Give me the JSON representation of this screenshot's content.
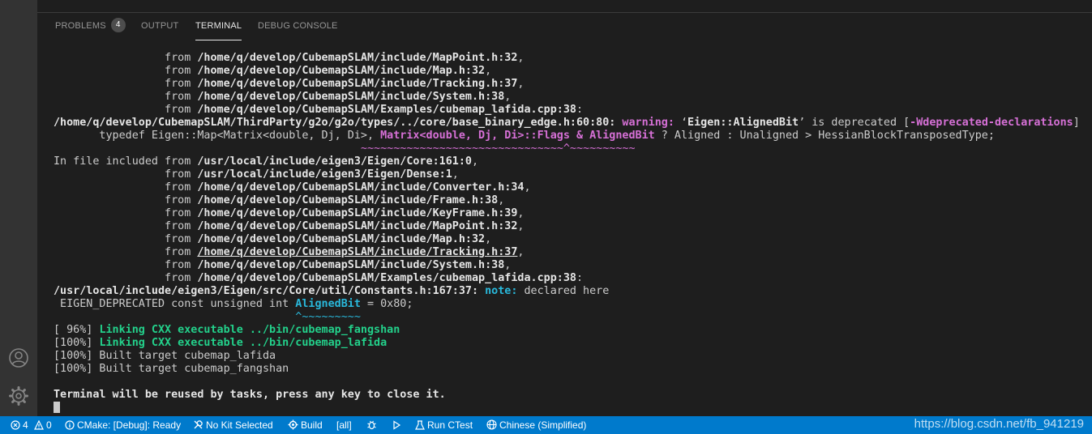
{
  "panel": {
    "tabs": [
      {
        "label": "PROBLEMS",
        "badge": "4"
      },
      {
        "label": "OUTPUT"
      },
      {
        "label": "TERMINAL"
      },
      {
        "label": "DEBUG CONSOLE"
      }
    ],
    "active_tab": "TERMINAL"
  },
  "terminal": {
    "lines": [
      [
        {
          "t": "                 from "
        },
        {
          "t": "/home/q/develop/CubemapSLAM/include/MapPoint.h:32",
          "c": "b"
        },
        {
          "t": ","
        }
      ],
      [
        {
          "t": "                 from "
        },
        {
          "t": "/home/q/develop/CubemapSLAM/include/Map.h:32",
          "c": "b"
        },
        {
          "t": ","
        }
      ],
      [
        {
          "t": "                 from "
        },
        {
          "t": "/home/q/develop/CubemapSLAM/include/Tracking.h:37",
          "c": "b"
        },
        {
          "t": ","
        }
      ],
      [
        {
          "t": "                 from "
        },
        {
          "t": "/home/q/develop/CubemapSLAM/include/System.h:38",
          "c": "b"
        },
        {
          "t": ","
        }
      ],
      [
        {
          "t": "                 from "
        },
        {
          "t": "/home/q/develop/CubemapSLAM/Examples/cubemap_lafida.cpp:38",
          "c": "b"
        },
        {
          "t": ":"
        }
      ],
      [
        {
          "t": "/home/q/develop/CubemapSLAM/ThirdParty/g2o/g2o/types/../core/base_binary_edge.h:60:80:",
          "c": "b"
        },
        {
          "t": " "
        },
        {
          "t": "warning:",
          "c": "warn"
        },
        {
          "t": " ‘"
        },
        {
          "t": "Eigen::AlignedBit",
          "c": "b"
        },
        {
          "t": "’ is deprecated ["
        },
        {
          "t": "-Wdeprecated-declarations",
          "c": "mag"
        },
        {
          "t": "]"
        }
      ],
      [
        {
          "t": "       typedef Eigen::Map<Matrix<double, Dj, Di>, "
        },
        {
          "t": "Matrix<double, Dj, Di>::Flags & AlignedBit",
          "c": "mag"
        },
        {
          "t": " ? Aligned : Unaligned > HessianBlockTransposedType;"
        }
      ],
      [
        {
          "t": "                                               ~~~~~~~~~~~~~~~~~~~~~~~~~~~~~~~^~~~~~~~~~~",
          "c": "magt"
        }
      ],
      [
        {
          "t": "In file included from "
        },
        {
          "t": "/usr/local/include/eigen3/Eigen/Core:161:0",
          "c": "b"
        },
        {
          "t": ","
        }
      ],
      [
        {
          "t": "                 from "
        },
        {
          "t": "/usr/local/include/eigen3/Eigen/Dense:1",
          "c": "b"
        },
        {
          "t": ","
        }
      ],
      [
        {
          "t": "                 from "
        },
        {
          "t": "/home/q/develop/CubemapSLAM/include/Converter.h:34",
          "c": "b"
        },
        {
          "t": ","
        }
      ],
      [
        {
          "t": "                 from "
        },
        {
          "t": "/home/q/develop/CubemapSLAM/include/Frame.h:38",
          "c": "b"
        },
        {
          "t": ","
        }
      ],
      [
        {
          "t": "                 from "
        },
        {
          "t": "/home/q/develop/CubemapSLAM/include/KeyFrame.h:39",
          "c": "b"
        },
        {
          "t": ","
        }
      ],
      [
        {
          "t": "                 from "
        },
        {
          "t": "/home/q/develop/CubemapSLAM/include/MapPoint.h:32",
          "c": "b"
        },
        {
          "t": ","
        }
      ],
      [
        {
          "t": "                 from "
        },
        {
          "t": "/home/q/develop/CubemapSLAM/include/Map.h:32",
          "c": "b"
        },
        {
          "t": ","
        }
      ],
      [
        {
          "t": "                 from "
        },
        {
          "t": "/home/q/develop/CubemapSLAM/include/Tracking.h:37",
          "c": "b ul"
        },
        {
          "t": ","
        }
      ],
      [
        {
          "t": "                 from "
        },
        {
          "t": "/home/q/develop/CubemapSLAM/include/System.h:38",
          "c": "b"
        },
        {
          "t": ","
        }
      ],
      [
        {
          "t": "                 from "
        },
        {
          "t": "/home/q/develop/CubemapSLAM/Examples/cubemap_lafida.cpp:38",
          "c": "b"
        },
        {
          "t": ":"
        }
      ],
      [
        {
          "t": "/usr/local/include/eigen3/Eigen/src/Core/util/Constants.h:167:37:",
          "c": "b"
        },
        {
          "t": " "
        },
        {
          "t": "note:",
          "c": "note"
        },
        {
          "t": " declared here"
        }
      ],
      [
        {
          "t": " EIGEN_DEPRECATED const unsigned int "
        },
        {
          "t": "AlignedBit",
          "c": "cyan"
        },
        {
          "t": " = 0x80;"
        }
      ],
      [
        {
          "t": "                                     ^~~~~~~~~~",
          "c": "cyant"
        }
      ],
      [
        {
          "t": "[ 96%] "
        },
        {
          "t": "Linking CXX executable ../bin/cubemap_fangshan",
          "c": "green"
        }
      ],
      [
        {
          "t": "[100%] "
        },
        {
          "t": "Linking CXX executable ../bin/cubemap_lafida",
          "c": "green"
        }
      ],
      [
        {
          "t": "[100%] Built target cubemap_lafida"
        }
      ],
      [
        {
          "t": "[100%] Built target cubemap_fangshan"
        }
      ],
      [
        {
          "t": ""
        }
      ],
      [
        {
          "t": "Terminal will be reused by tasks, press any key to close it.",
          "c": "b"
        }
      ]
    ]
  },
  "status_bar": {
    "errors": "4",
    "warnings": "0",
    "cmake_status": "CMake: [Debug]: Ready",
    "kit": "No Kit Selected",
    "build": "Build",
    "target": "[all]",
    "ctest": "Run CTest",
    "language": "Chinese (Simplified)"
  },
  "watermark": "https://blog.csdn.net/fb_941219",
  "icons": [
    "account-icon",
    "gear-icon",
    "error-icon",
    "warning-icon",
    "info-icon",
    "kit-icon",
    "build-gear-icon",
    "debug-bug-icon",
    "run-play-icon",
    "beaker-icon",
    "globe-icon"
  ],
  "colors": {
    "status_bar": "#007acc",
    "activity_bar": "#333333",
    "terminal_bg": "#1e1e1e",
    "warning": "#d670d6",
    "note": "#29b8db",
    "success": "#23d18b"
  }
}
